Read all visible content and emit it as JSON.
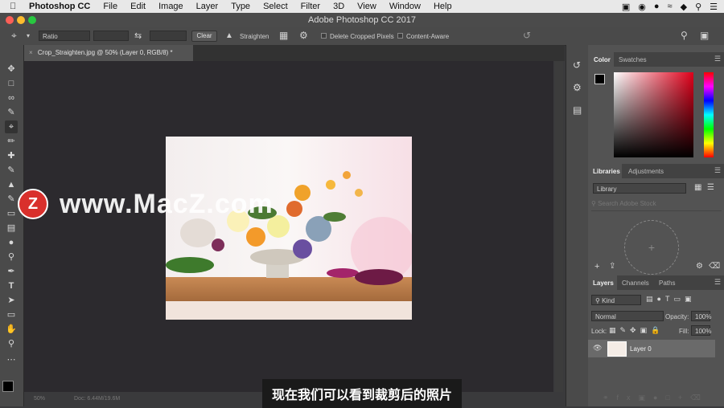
{
  "menubar": {
    "app_name": "Photoshop CC",
    "items": [
      "File",
      "Edit",
      "Image",
      "Layer",
      "Type",
      "Select",
      "Filter",
      "3D",
      "View",
      "Window",
      "Help"
    ]
  },
  "window": {
    "title": "Adobe Photoshop CC 2017"
  },
  "options_bar": {
    "ratio_value": "Ratio",
    "clear_label": "Clear",
    "straighten_label": "Straighten",
    "delete_cropped_label": "Delete Cropped Pixels",
    "content_aware_label": "Content-Aware"
  },
  "document": {
    "tab_label": "Crop_Straighten.jpg @ 50% (Layer 0, RGB/8) *"
  },
  "color_panel": {
    "tab_color": "Color",
    "tab_swatches": "Swatches"
  },
  "libraries_panel": {
    "tab_libraries": "Libraries",
    "tab_adjustments": "Adjustments",
    "library_select": "Library",
    "search_placeholder": "Search Adobe Stock"
  },
  "layers_panel": {
    "tab_layers": "Layers",
    "tab_channels": "Channels",
    "tab_paths": "Paths",
    "kind_label": "Kind",
    "blend_mode": "Normal",
    "opacity_label": "Opacity:",
    "opacity_value": "100%",
    "lock_label": "Lock:",
    "fill_label": "Fill:",
    "fill_value": "100%",
    "layer_name": "Layer 0"
  },
  "status": {
    "zoom": "50%",
    "doc_size": "Doc: 6.44M/19.6M"
  },
  "watermark": {
    "logo_letter": "Z",
    "text": "www.MacZ.com"
  },
  "subtitle": "现在我们可以看到裁剪后的照片",
  "colors": {
    "accent_red": "#d9302c",
    "panel": "#535353",
    "toolbar": "#4a4a4a"
  }
}
